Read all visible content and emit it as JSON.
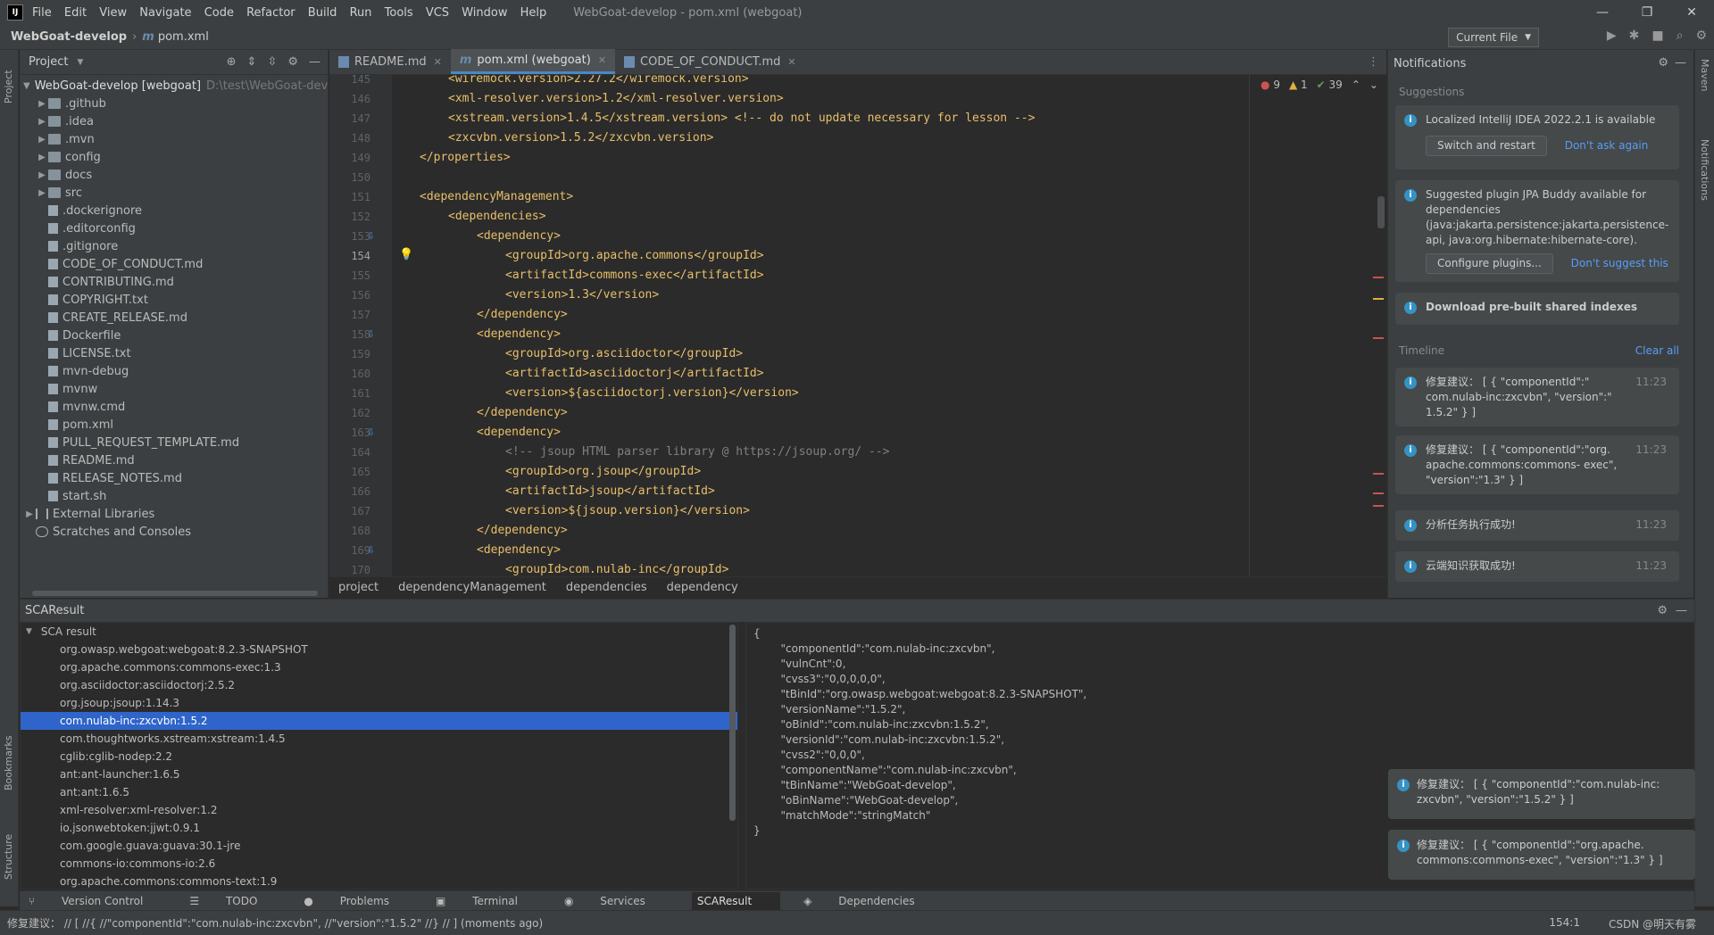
{
  "window": {
    "app_logo": "IJ",
    "menu": [
      "File",
      "Edit",
      "View",
      "Navigate",
      "Code",
      "Refactor",
      "Build",
      "Run",
      "Tools",
      "VCS",
      "Window",
      "Help"
    ],
    "title": "WebGoat-develop - pom.xml (webgoat)",
    "controls": [
      "—",
      "❐",
      "✕"
    ]
  },
  "navbar": {
    "project": "WebGoat-develop",
    "file": "pom.xml",
    "run_config": "Current File"
  },
  "left_stripe": {
    "project": "Project",
    "bookmarks": "Bookmarks",
    "structure": "Structure"
  },
  "right_stripe": {
    "maven": "Maven",
    "notifications": "Notifications"
  },
  "project_panel": {
    "title": "Project",
    "root": "WebGoat-develop [webgoat]",
    "root_path": "D:\\test\\WebGoat-dev",
    "folders": [
      ".github",
      ".idea",
      ".mvn",
      "config",
      "docs",
      "src"
    ],
    "files": [
      ".dockerignore",
      ".editorconfig",
      ".gitignore",
      "CODE_OF_CONDUCT.md",
      "CONTRIBUTING.md",
      "COPYRIGHT.txt",
      "CREATE_RELEASE.md",
      "Dockerfile",
      "LICENSE.txt",
      "mvn-debug",
      "mvnw",
      "mvnw.cmd",
      "pom.xml",
      "PULL_REQUEST_TEMPLATE.md",
      "README.md",
      "RELEASE_NOTES.md",
      "start.sh"
    ],
    "extra": [
      "External Libraries",
      "Scratches and Consoles"
    ]
  },
  "editor": {
    "tabs": [
      "README.md",
      "pom.xml (webgoat)",
      "CODE_OF_CONDUCT.md"
    ],
    "inspections": {
      "errors": "9",
      "warnings": "1",
      "ok": "39"
    },
    "lines": [
      {
        "n": "145",
        "t": "<wiremock.version>2.27.2</wiremock.version>",
        "indent": 1
      },
      {
        "n": "146",
        "t": "<xml-resolver.version>1.2</xml-resolver.version>",
        "indent": 1
      },
      {
        "n": "147",
        "t": "<xstream.version>1.4.5</xstream.version> <!-- do not update necessary for lesson -->",
        "indent": 1
      },
      {
        "n": "148",
        "t": "<zxcvbn.version>1.5.2</zxcvbn.version>",
        "indent": 1
      },
      {
        "n": "149",
        "t": "</properties>",
        "indent": 0
      },
      {
        "n": "150",
        "t": "",
        "indent": 0
      },
      {
        "n": "151",
        "t": "<dependencyManagement>",
        "indent": 0
      },
      {
        "n": "152",
        "t": "<dependencies>",
        "indent": 1
      },
      {
        "n": "153",
        "t": "<dependency>",
        "indent": 2
      },
      {
        "n": "154",
        "t": "<groupId>org.apache.commons</groupId>",
        "indent": 3
      },
      {
        "n": "155",
        "t": "<artifactId>commons-exec</artifactId>",
        "indent": 3
      },
      {
        "n": "156",
        "t": "<version>1.3</version>",
        "indent": 3
      },
      {
        "n": "157",
        "t": "</dependency>",
        "indent": 2
      },
      {
        "n": "158",
        "t": "<dependency>",
        "indent": 2
      },
      {
        "n": "159",
        "t": "<groupId>org.asciidoctor</groupId>",
        "indent": 3
      },
      {
        "n": "160",
        "t": "<artifactId>asciidoctorj</artifactId>",
        "indent": 3
      },
      {
        "n": "161",
        "t": "<version>${asciidoctorj.version}</version>",
        "indent": 3
      },
      {
        "n": "162",
        "t": "</dependency>",
        "indent": 2
      },
      {
        "n": "163",
        "t": "<dependency>",
        "indent": 2
      },
      {
        "n": "164",
        "t": "<!-- jsoup HTML parser library @ https://jsoup.org/ -->",
        "indent": 3
      },
      {
        "n": "165",
        "t": "<groupId>org.jsoup</groupId>",
        "indent": 3
      },
      {
        "n": "166",
        "t": "<artifactId>jsoup</artifactId>",
        "indent": 3
      },
      {
        "n": "167",
        "t": "<version>${jsoup.version}</version>",
        "indent": 3
      },
      {
        "n": "168",
        "t": "</dependency>",
        "indent": 2
      },
      {
        "n": "169",
        "t": "<dependency>",
        "indent": 2
      },
      {
        "n": "170",
        "t": "<groupId>com.nulab-inc</groupId>",
        "indent": 3
      }
    ],
    "breadcrumb": [
      "project",
      "dependencyManagement",
      "dependencies",
      "dependency"
    ]
  },
  "notifications": {
    "title": "Notifications",
    "suggestions_label": "Suggestions",
    "timeline_label": "Timeline",
    "clear_all": "Clear all",
    "cards": [
      {
        "text": "Localized IntelliJ IDEA 2022.2.1 is available",
        "btn": "Switch and restart",
        "link": "Don't ask again"
      },
      {
        "text": "Suggested plugin JPA Buddy available for dependencies (java:jakarta.persistence:jakarta.persistence-api, java:org.hibernate:hibernate-core).",
        "btn": "Configure plugins...",
        "link": "Don't suggest this"
      },
      {
        "text": "Download pre-built shared indexes"
      }
    ],
    "timeline": [
      {
        "text": "修复建议： [ { \"componentId\":\" com.nulab-inc:zxcvbn\", \"version\":\" 1.5.2\" } ]",
        "time": "11:23"
      },
      {
        "text": "修复建议： [ { \"componentId\":\"org. apache.commons:commons- exec\", \"version\":\"1.3\" } ]",
        "time": "11:23"
      },
      {
        "text": "分析任务执行成功!",
        "time": "11:23"
      },
      {
        "text": "云端知识获取成功!",
        "time": "11:23"
      }
    ]
  },
  "sca": {
    "title": "SCAResult",
    "root": "SCA result",
    "items": [
      "org.owasp.webgoat:webgoat:8.2.3-SNAPSHOT",
      "org.apache.commons:commons-exec:1.3",
      "org.asciidoctor:asciidoctorj:2.5.2",
      "org.jsoup:jsoup:1.14.3",
      "com.nulab-inc:zxcvbn:1.5.2",
      "com.thoughtworks.xstream:xstream:1.4.5",
      "cglib:cglib-nodep:2.2",
      "ant:ant-launcher:1.6.5",
      "ant:ant:1.6.5",
      "xml-resolver:xml-resolver:1.2",
      "io.jsonwebtoken:jjwt:0.9.1",
      "com.google.guava:guava:30.1-jre",
      "commons-io:commons-io:2.6",
      "org.apache.commons:commons-text:1.9"
    ],
    "selected_index": 4,
    "json_lines": [
      "{",
      "        \"componentId\":\"com.nulab-inc:zxcvbn\",",
      "        \"vulnCnt\":0,",
      "        \"cvss3\":\"0,0,0,0,0\",",
      "        \"tBinId\":\"org.owasp.webgoat:webgoat:8.2.3-SNAPSHOT\",",
      "        \"versionName\":\"1.5.2\",",
      "        \"oBinId\":\"com.nulab-inc:zxcvbn:1.5.2\",",
      "        \"versionId\":\"com.nulab-inc:zxcvbn:1.5.2\",",
      "        \"cvss2\":\"0,0,0\",",
      "        \"componentName\":\"com.nulab-inc:zxcvbn\",",
      "        \"tBinName\":\"WebGoat-develop\",",
      "        \"oBinName\":\"WebGoat-develop\",",
      "        \"matchMode\":\"stringMatch\"",
      "}"
    ],
    "toasts": [
      "修复建议： [ { \"componentId\":\"com.nulab-inc: zxcvbn\", \"version\":\"1.5.2\" } ]",
      "修复建议： [ { \"componentId\":\"org.apache. commons:commons-exec\", \"version\":\"1.3\" } ]"
    ]
  },
  "tool_tabs": [
    "Version Control",
    "TODO",
    "Problems",
    "Terminal",
    "Services",
    "SCAResult",
    "Dependencies"
  ],
  "status": {
    "message": "修复建议： // [ //{ //\"componentId\":\"com.nulab-inc:zxcvbn\", //\"version\":\"1.5.2\" //} // ] (moments ago)",
    "position": "154:1",
    "watermark": "CSDN @明天有雾"
  }
}
